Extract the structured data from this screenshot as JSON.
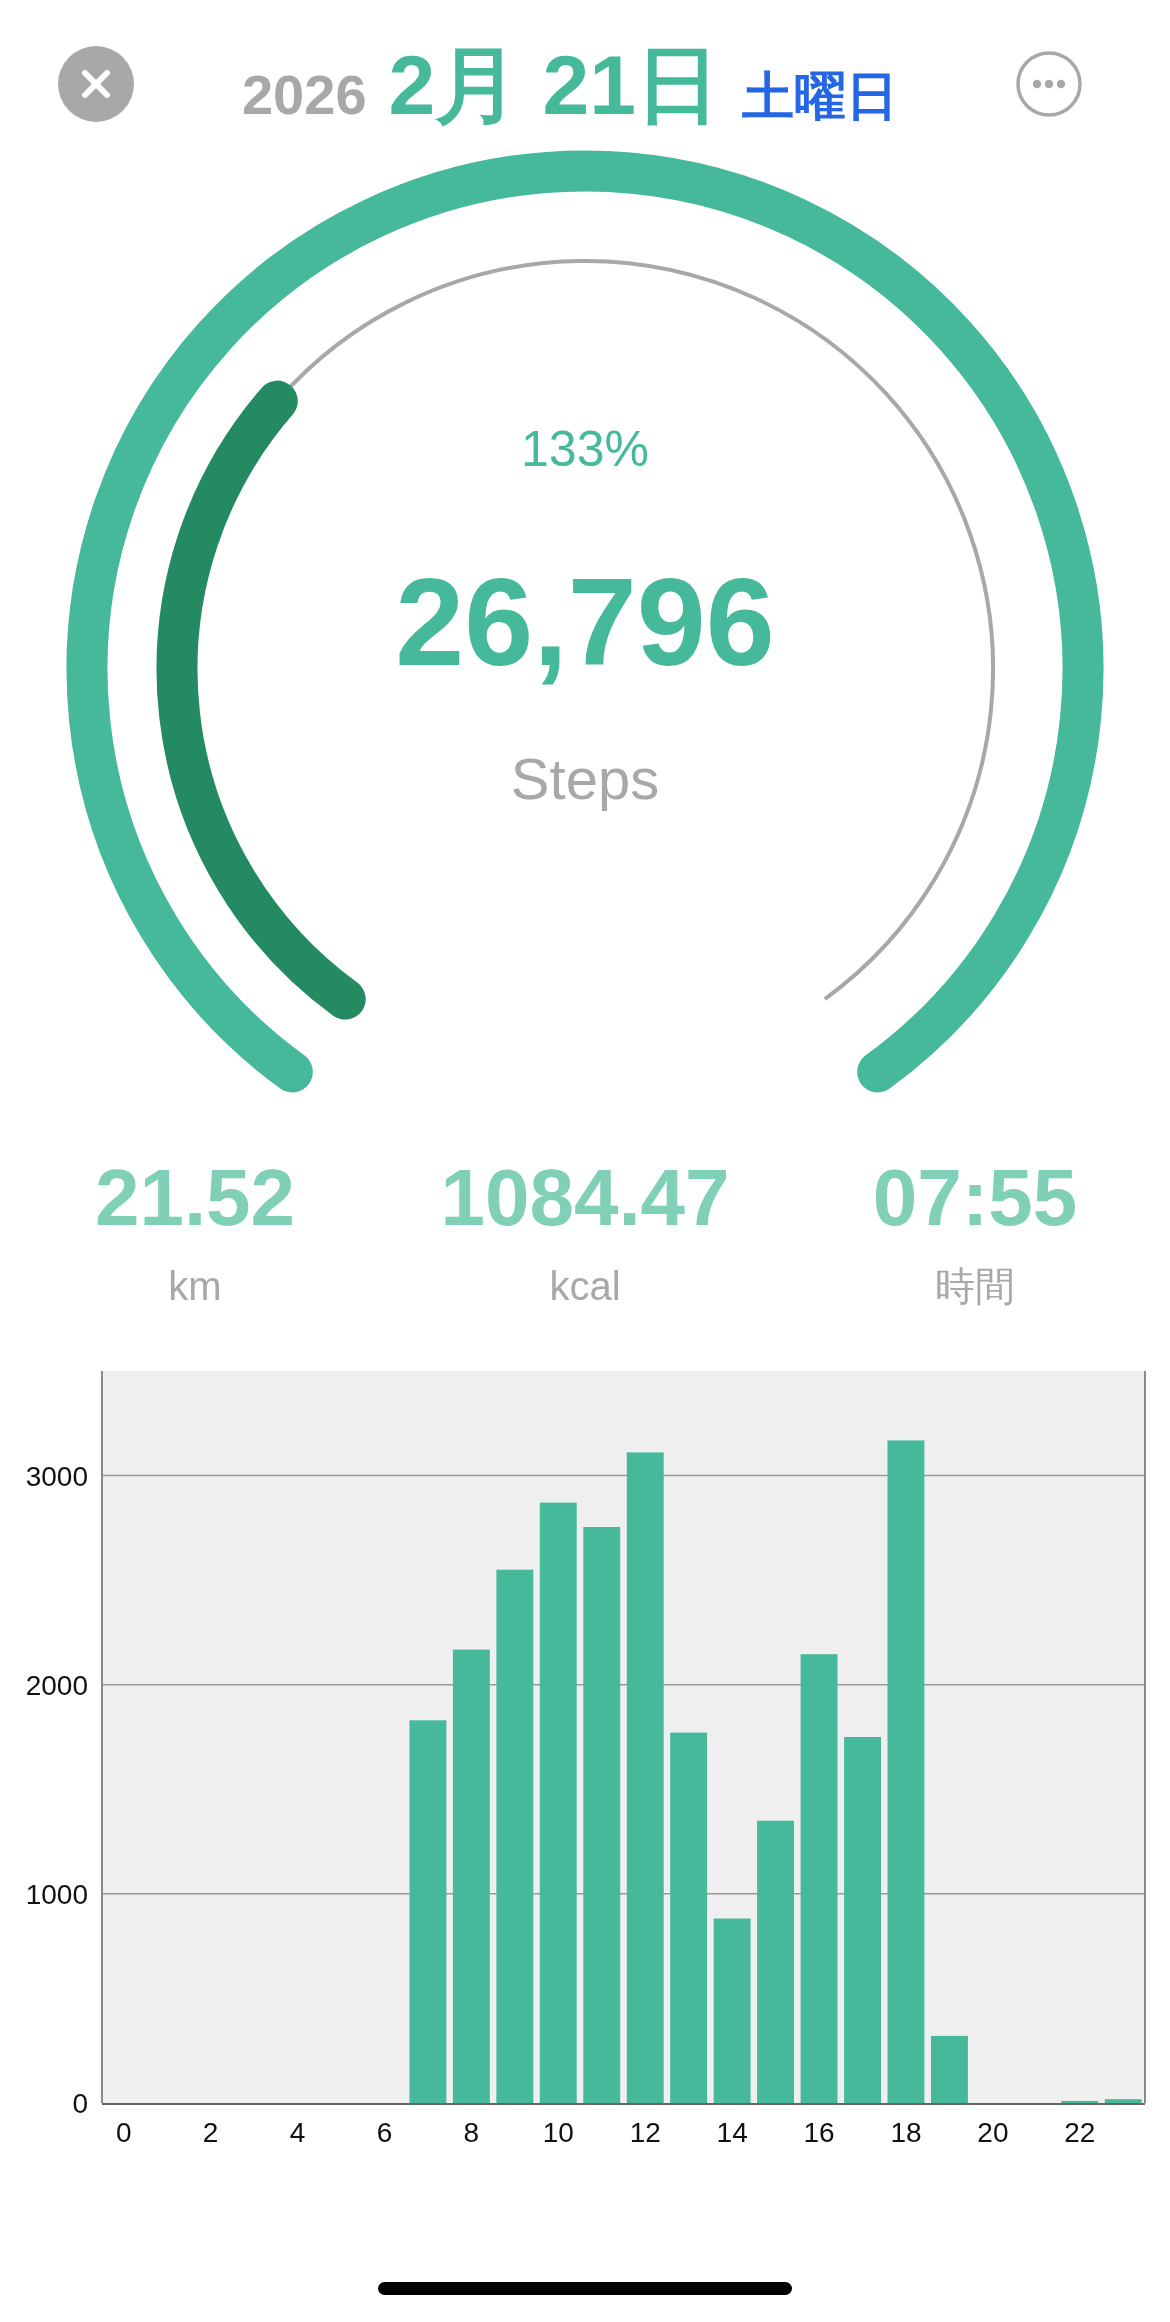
{
  "header": {
    "year": "2026",
    "date": "2月 21日",
    "weekday": "土曜日"
  },
  "gauge": {
    "percent": "133%",
    "steps": "26,796",
    "unit": "Steps"
  },
  "stats": [
    {
      "value": "21.52",
      "unit": "km"
    },
    {
      "value": "1084.47",
      "unit": "kcal"
    },
    {
      "value": "07:55",
      "unit": "時間"
    }
  ],
  "chart_data": {
    "type": "bar",
    "x": [
      0,
      1,
      2,
      3,
      4,
      5,
      6,
      7,
      8,
      9,
      10,
      11,
      12,
      13,
      14,
      15,
      16,
      17,
      18,
      19,
      20,
      21,
      22,
      23
    ],
    "grid": true,
    "series": [
      {
        "color": "#45b99a",
        "values": [
          0,
          0,
          0,
          0,
          0,
          0,
          0,
          1830,
          2168,
          2550,
          2871,
          2754,
          3111,
          1771,
          882,
          1350,
          2146,
          1750,
          3168,
          321,
          0,
          0,
          10,
          18
        ]
      }
    ],
    "xlim": [
      -0.5,
      23.5
    ],
    "ylim": [
      0,
      3500
    ],
    "xticks": [
      0,
      2,
      4,
      6,
      8,
      10,
      12,
      14,
      16,
      18,
      20,
      22
    ],
    "yticks": [
      0,
      1000,
      2000,
      3000
    ]
  }
}
